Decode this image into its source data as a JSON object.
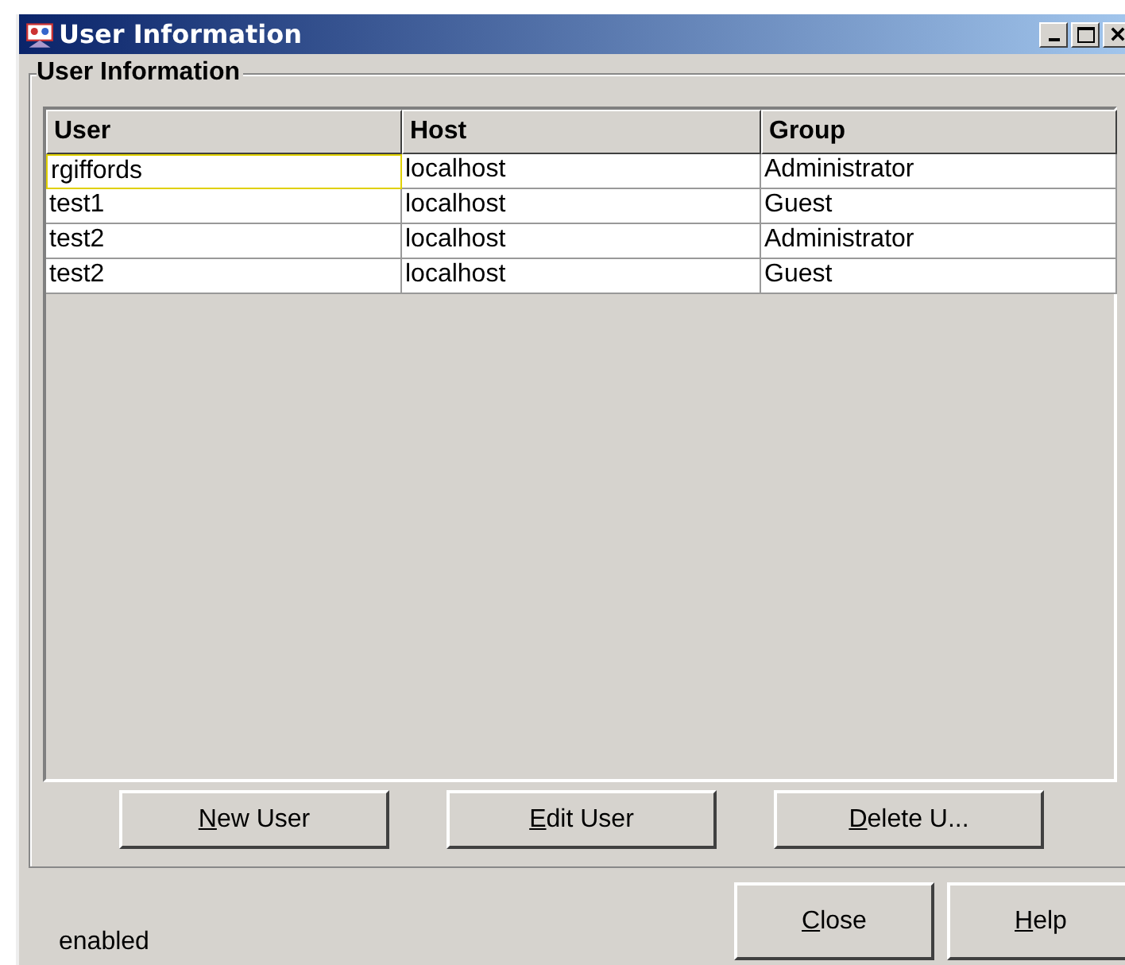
{
  "window": {
    "title": "User Information"
  },
  "group": {
    "title": "User Information"
  },
  "table": {
    "columns": [
      "User",
      "Host",
      "Group"
    ],
    "rows": [
      {
        "cells": [
          "rgiffords",
          "localhost",
          "Administrator"
        ],
        "focused": true
      },
      {
        "cells": [
          "test1",
          "localhost",
          "Guest"
        ],
        "focused": false
      },
      {
        "cells": [
          "test2",
          "localhost",
          "Administrator"
        ],
        "focused": false
      },
      {
        "cells": [
          "test2",
          "localhost",
          "Guest"
        ],
        "focused": false
      }
    ]
  },
  "table_buttons": [
    "New User",
    "Edit User",
    "Delete U..."
  ],
  "status": "enabled",
  "dialog_buttons": [
    "Close",
    "Help"
  ]
}
